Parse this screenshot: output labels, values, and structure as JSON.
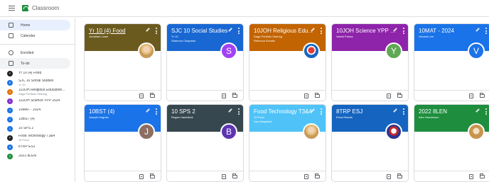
{
  "app": {
    "title": "Classroom"
  },
  "nav": [
    {
      "label": "Home",
      "icon": "home-icon",
      "active": true
    },
    {
      "label": "Calendar",
      "icon": "calendar-icon",
      "active": false
    },
    {
      "label": "Enrolled",
      "icon": "enrolled-icon",
      "active": false
    },
    {
      "label": "To-do",
      "icon": "todo-icon",
      "active": false
    }
  ],
  "class_list": [
    {
      "initial": "Y",
      "name": "Yr 10 (4) Food",
      "sub": "",
      "color": "#202124"
    },
    {
      "initial": "S",
      "name": "SJC 10 Social Studies",
      "sub": "Yr 10",
      "color": "#1a73e8"
    },
    {
      "initial": "1",
      "name": "10JOH Religious Education...",
      "sub": "Saga Portfolio Sharing",
      "color": "#e37400"
    },
    {
      "initial": "1",
      "name": "10JOH Science YPP 2024",
      "sub": "",
      "color": "#8430ce"
    },
    {
      "initial": "1",
      "name": "10MAT - 2024",
      "sub": "",
      "color": "#1a73e8"
    },
    {
      "initial": "1",
      "name": "10BST (4)",
      "sub": "",
      "color": "#1a73e8"
    },
    {
      "initial": "1",
      "name": "10 SPS 2",
      "sub": "",
      "color": "#1a73e8"
    },
    {
      "initial": "F",
      "name": "Food Technology T3&4",
      "sub": "10 Food",
      "color": "#202124"
    },
    {
      "initial": "8",
      "name": "8TRP ESJ",
      "sub": "",
      "color": "#1a73e8"
    },
    {
      "initial": "2",
      "name": "2022 8LEN",
      "sub": "",
      "color": "#1e8e3e"
    }
  ],
  "cards": [
    {
      "title": "Yr 10 (4) Food",
      "sub": "",
      "teacher": "Jonathan Lowe",
      "banner": "#6b5a1e",
      "avatar_type": "photo",
      "avatar_letter": "",
      "avatar_color": "",
      "underline": true
    },
    {
      "title": "SJC 10 Social Studies",
      "sub": "Yr 10",
      "teacher": "Shannon Chapman",
      "banner": "#1967d2",
      "avatar_type": "letter",
      "avatar_letter": "S",
      "avatar_color": "#a142f4",
      "underline": false
    },
    {
      "title": "10JOH Religious Edu...",
      "sub": "Saga Portfolio Sharing",
      "teacher": "Rebecca Schultz",
      "banner": "#c26401",
      "avatar_type": "crest",
      "avatar_letter": "",
      "avatar_color": "",
      "underline": false
    },
    {
      "title": "10JOH Science YPP 2...",
      "sub": "",
      "teacher": "Vashti Palora",
      "banner": "#8e24aa",
      "avatar_type": "letter",
      "avatar_letter": "Y",
      "avatar_color": "#5fa855",
      "underline": false
    },
    {
      "title": "10MAT - 2024",
      "sub": "",
      "teacher": "Vincent Lee",
      "banner": "#1a73e8",
      "avatar_type": "letter",
      "avatar_letter": "V",
      "avatar_color": "#1a73e8",
      "underline": false
    },
    {
      "title": "10BST (4)",
      "sub": "",
      "teacher": "Joseph Hughes",
      "banner": "#1a73e8",
      "avatar_type": "letter",
      "avatar_letter": "J",
      "avatar_color": "#8d6e63",
      "underline": false
    },
    {
      "title": "10 SPS 2",
      "sub": "",
      "teacher": "Regan Hambleck",
      "banner": "#37474f",
      "avatar_type": "letter",
      "avatar_letter": "B",
      "avatar_color": "#5e35b1",
      "underline": false
    },
    {
      "title": "Food Technology T3&4",
      "sub": "10 Food",
      "teacher": "Lisa Kingsford",
      "banner": "#4fc3f7",
      "avatar_type": "photo",
      "avatar_letter": "",
      "avatar_color": "",
      "underline": false
    },
    {
      "title": "8TRP ESJ",
      "sub": "",
      "teacher": "Erica Reams",
      "banner": "#1565c0",
      "avatar_type": "crest2",
      "avatar_letter": "",
      "avatar_color": "",
      "underline": false
    },
    {
      "title": "2022 8LEN",
      "sub": "",
      "teacher": "Alex Henderson",
      "banner": "#1e8e3e",
      "avatar_type": "dog",
      "avatar_letter": "",
      "avatar_color": "",
      "underline": false
    }
  ]
}
